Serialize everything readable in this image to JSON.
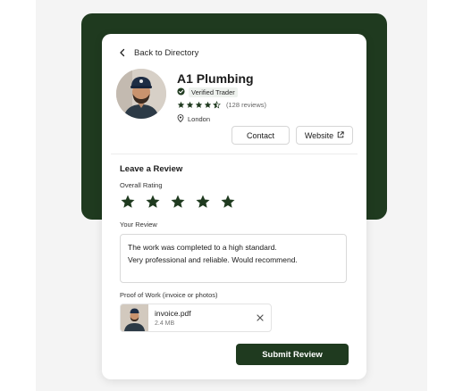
{
  "navigation": {
    "back_label": "Back to Directory"
  },
  "trader": {
    "name": "A1 Plumbing",
    "verified_label": "Verified Trader",
    "rating": 4.5,
    "reviews_text": "(128 reviews)",
    "location": "London"
  },
  "actions": {
    "contact_label": "Contact",
    "website_label": "Website"
  },
  "review_form": {
    "title": "Leave a Review",
    "overall_rating_label": "Overall Rating",
    "selected_stars": 5,
    "your_review_label": "Your Review",
    "review_line_1": "The work was completed to a high standard.",
    "review_line_2": "Very professional and reliable. Would recommend.",
    "proof_label": "Proof of Work (invoice or photos)",
    "attachment": {
      "file_name": "invoice.pdf",
      "file_size": "2.4 MB"
    },
    "submit_label": "Submit Review"
  },
  "colors": {
    "brand_green": "#1f3a1f",
    "star_color": "#1f3a1f",
    "background": "#f4f4f4"
  },
  "icons": {
    "back": "chevron-left-icon",
    "verified": "check-circle-icon",
    "location": "map-pin-icon",
    "website": "external-link-icon",
    "remove_file": "close-icon",
    "rating": "star-icon"
  }
}
